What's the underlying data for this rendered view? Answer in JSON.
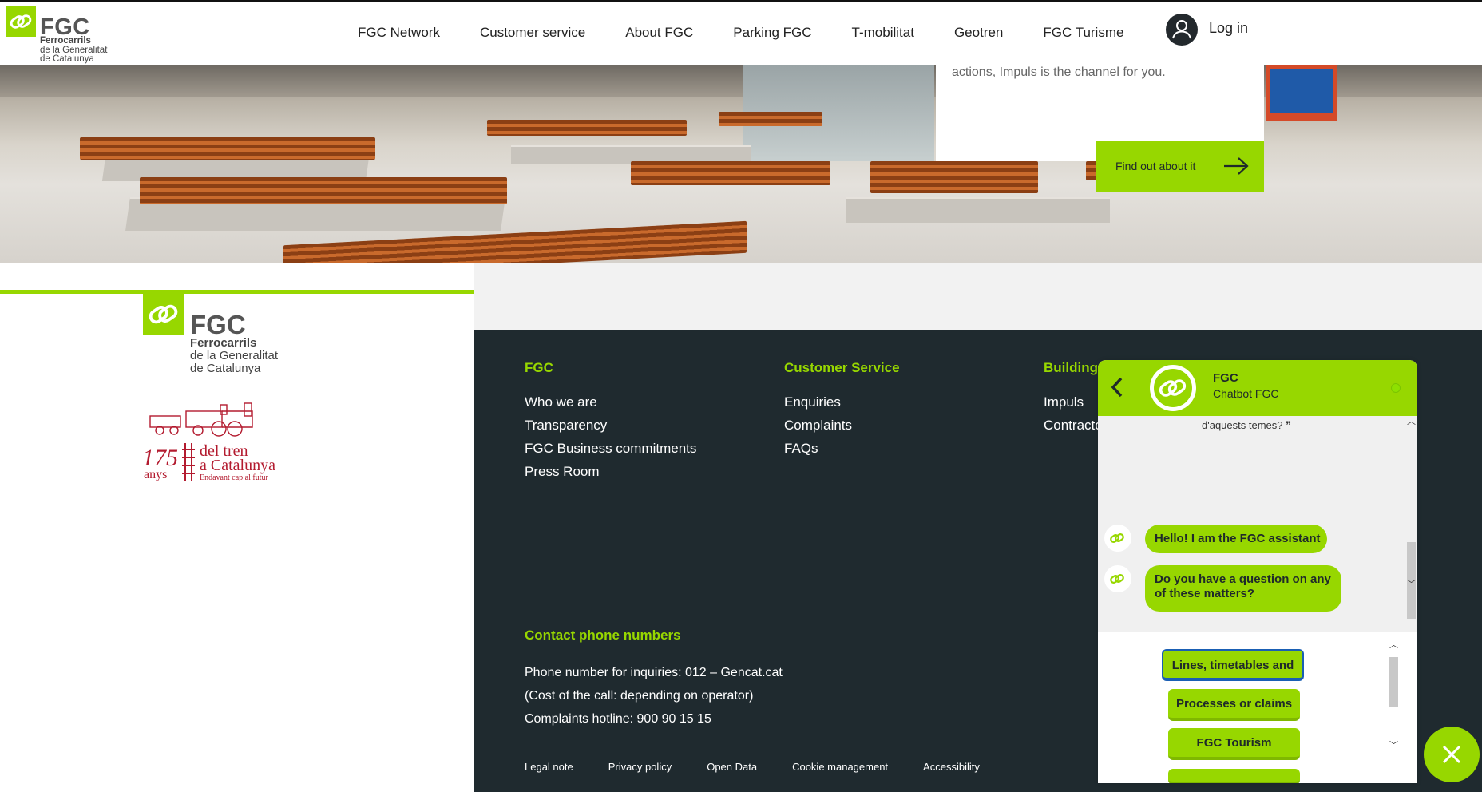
{
  "header": {
    "logo": {
      "name": "FGC",
      "line1": "Ferrocarrils",
      "line2": "de la Generalitat",
      "line3": "de Catalunya"
    },
    "nav": [
      "FGC Network",
      "Customer service",
      "About FGC",
      "Parking FGC",
      "T-mobilitat",
      "Geotren",
      "FGC Turisme"
    ],
    "login_label": "Log in"
  },
  "hero": {
    "promo_text": "actions, Impuls is the channel for you.",
    "promo_button": "Find out about it"
  },
  "footer": {
    "logo": {
      "name": "FGC",
      "line1": "Ferrocarrils",
      "line2": "de la Generalitat",
      "line3": "de Catalunya"
    },
    "anniversary": {
      "number": "175",
      "unit": "anys",
      "line1": "del tren",
      "line2": "a Catalunya",
      "tagline": "Endavant cap al futur"
    },
    "columns": [
      {
        "heading": "FGC",
        "links": [
          "Who we are",
          "Transparency",
          "FGC Business commitments",
          "Press Room"
        ]
      },
      {
        "heading": "Customer Service",
        "links": [
          "Enquiries",
          "Complaints",
          "FAQs"
        ]
      },
      {
        "heading": "Building",
        "links": [
          "Impuls",
          "Contracto"
        ]
      }
    ],
    "contact": {
      "heading": "Contact phone numbers",
      "lines": [
        "Phone number for inquiries: 012 – Gencat.cat",
        "(Cost of the call: depending on operator)",
        "Complaints hotline: 900 90 15 15"
      ]
    },
    "legal_links": [
      "Legal note",
      "Privacy policy",
      "Open Data",
      "Cookie management",
      "Accessibility"
    ]
  },
  "chatbot": {
    "title": "FGC",
    "subtitle": "Chatbot FGC",
    "previous_fragment": "d'aquests temes? ❞",
    "messages": [
      "Hello! I am the FGC assistant",
      "Do you have a question on any of these matters?"
    ],
    "options": [
      "Lines, timetables and fares",
      "Processes or claims",
      "FGC Tourism"
    ]
  },
  "colors": {
    "brand_green": "#97d700",
    "footer_dark": "#1f2a2f",
    "text_dark": "#222222"
  }
}
